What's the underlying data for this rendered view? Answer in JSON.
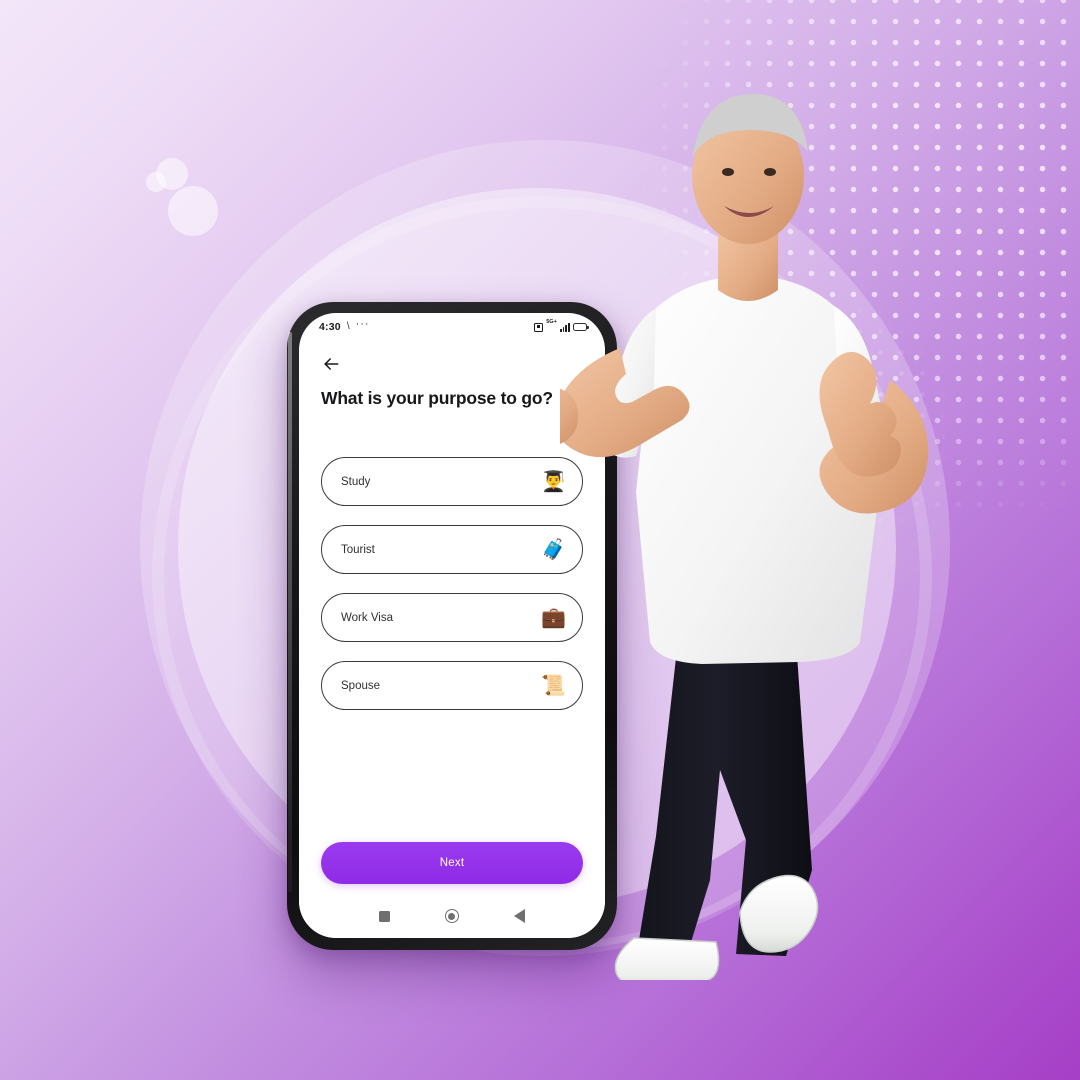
{
  "scene": {
    "background_gradient_from": "#f3e6f9",
    "background_gradient_to": "#a63fc6",
    "accent_color": "#9333ea"
  },
  "phone": {
    "status_bar": {
      "time": "4:30",
      "slash_icon": "\\",
      "more_dots": "···",
      "nfc_icon": "nfc-icon",
      "network_label": "5G+",
      "signal_icon": "signal-bars-icon",
      "battery_icon": "battery-icon"
    },
    "app": {
      "back_icon": "back-arrow-icon",
      "title": "What is your purpose to go?",
      "options": [
        {
          "label": "Study",
          "emoji": "👨‍🎓",
          "icon_name": "graduate-icon"
        },
        {
          "label": "Tourist",
          "emoji": "🧳",
          "icon_name": "traveler-luggage-icon"
        },
        {
          "label": "Work Visa",
          "emoji": "💼",
          "icon_name": "work-visa-document-icon"
        },
        {
          "label": "Spouse",
          "emoji": "📜",
          "icon_name": "certificate-scroll-icon"
        }
      ],
      "primary_button": "Next"
    },
    "nav_bar": {
      "recents_icon": "recents-square-icon",
      "home_icon": "home-circle-icon",
      "back_icon": "back-triangle-icon"
    }
  }
}
